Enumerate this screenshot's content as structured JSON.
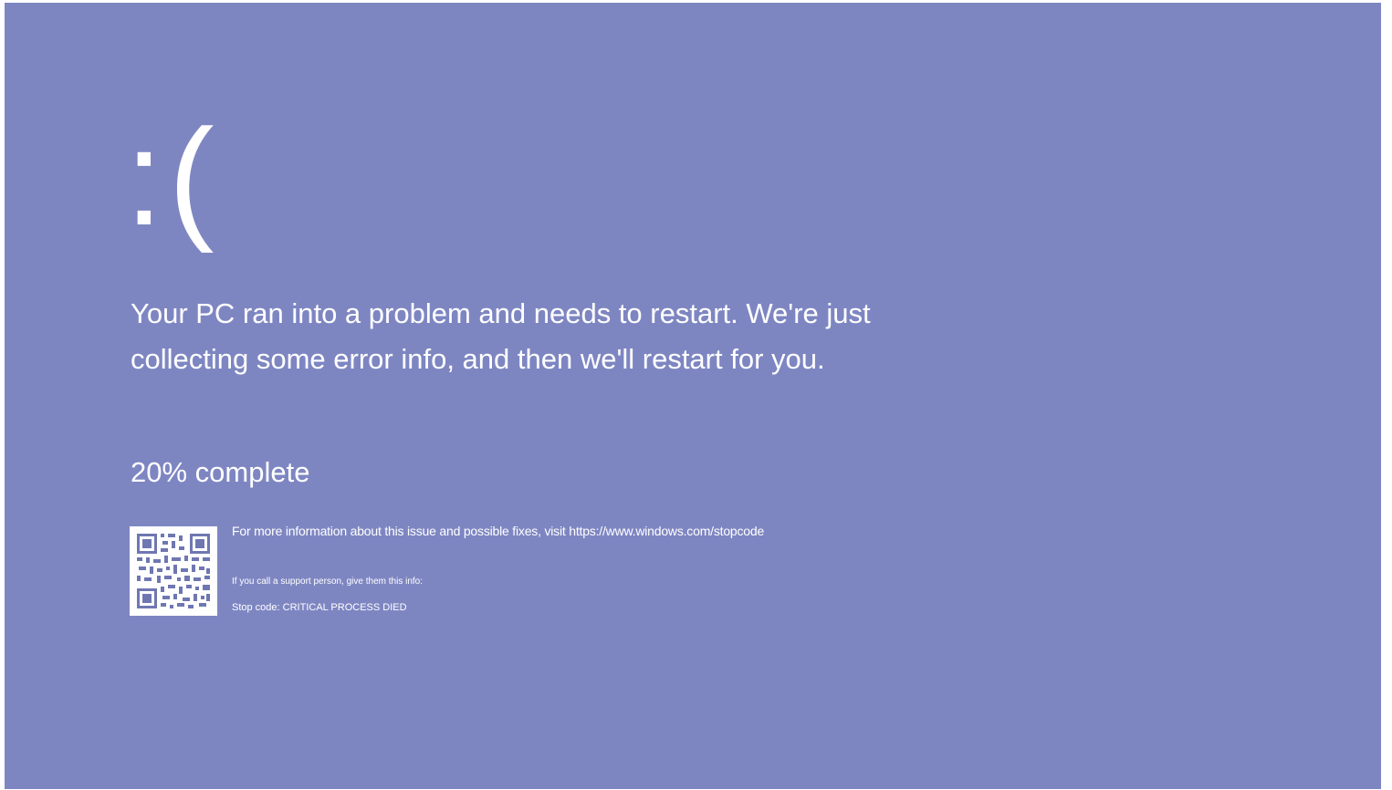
{
  "screen": {
    "background_color": "#7e86c2",
    "text_color": "#ffffff",
    "emoticon": ":(",
    "message": "Your PC ran into a problem and needs to restart. We're just collecting some error info, and then we'll restart for you.",
    "progress_text": "20% complete",
    "progress_percent": 20,
    "qr_icon": "qr-code-icon",
    "more_info_text": "For more information about this issue and possible fixes, visit https://www.windows.com/stopcode",
    "support_text": "If you call a support person, give them this info:",
    "stop_code_text": "Stop code: CRITICAL PROCESS DIED"
  }
}
